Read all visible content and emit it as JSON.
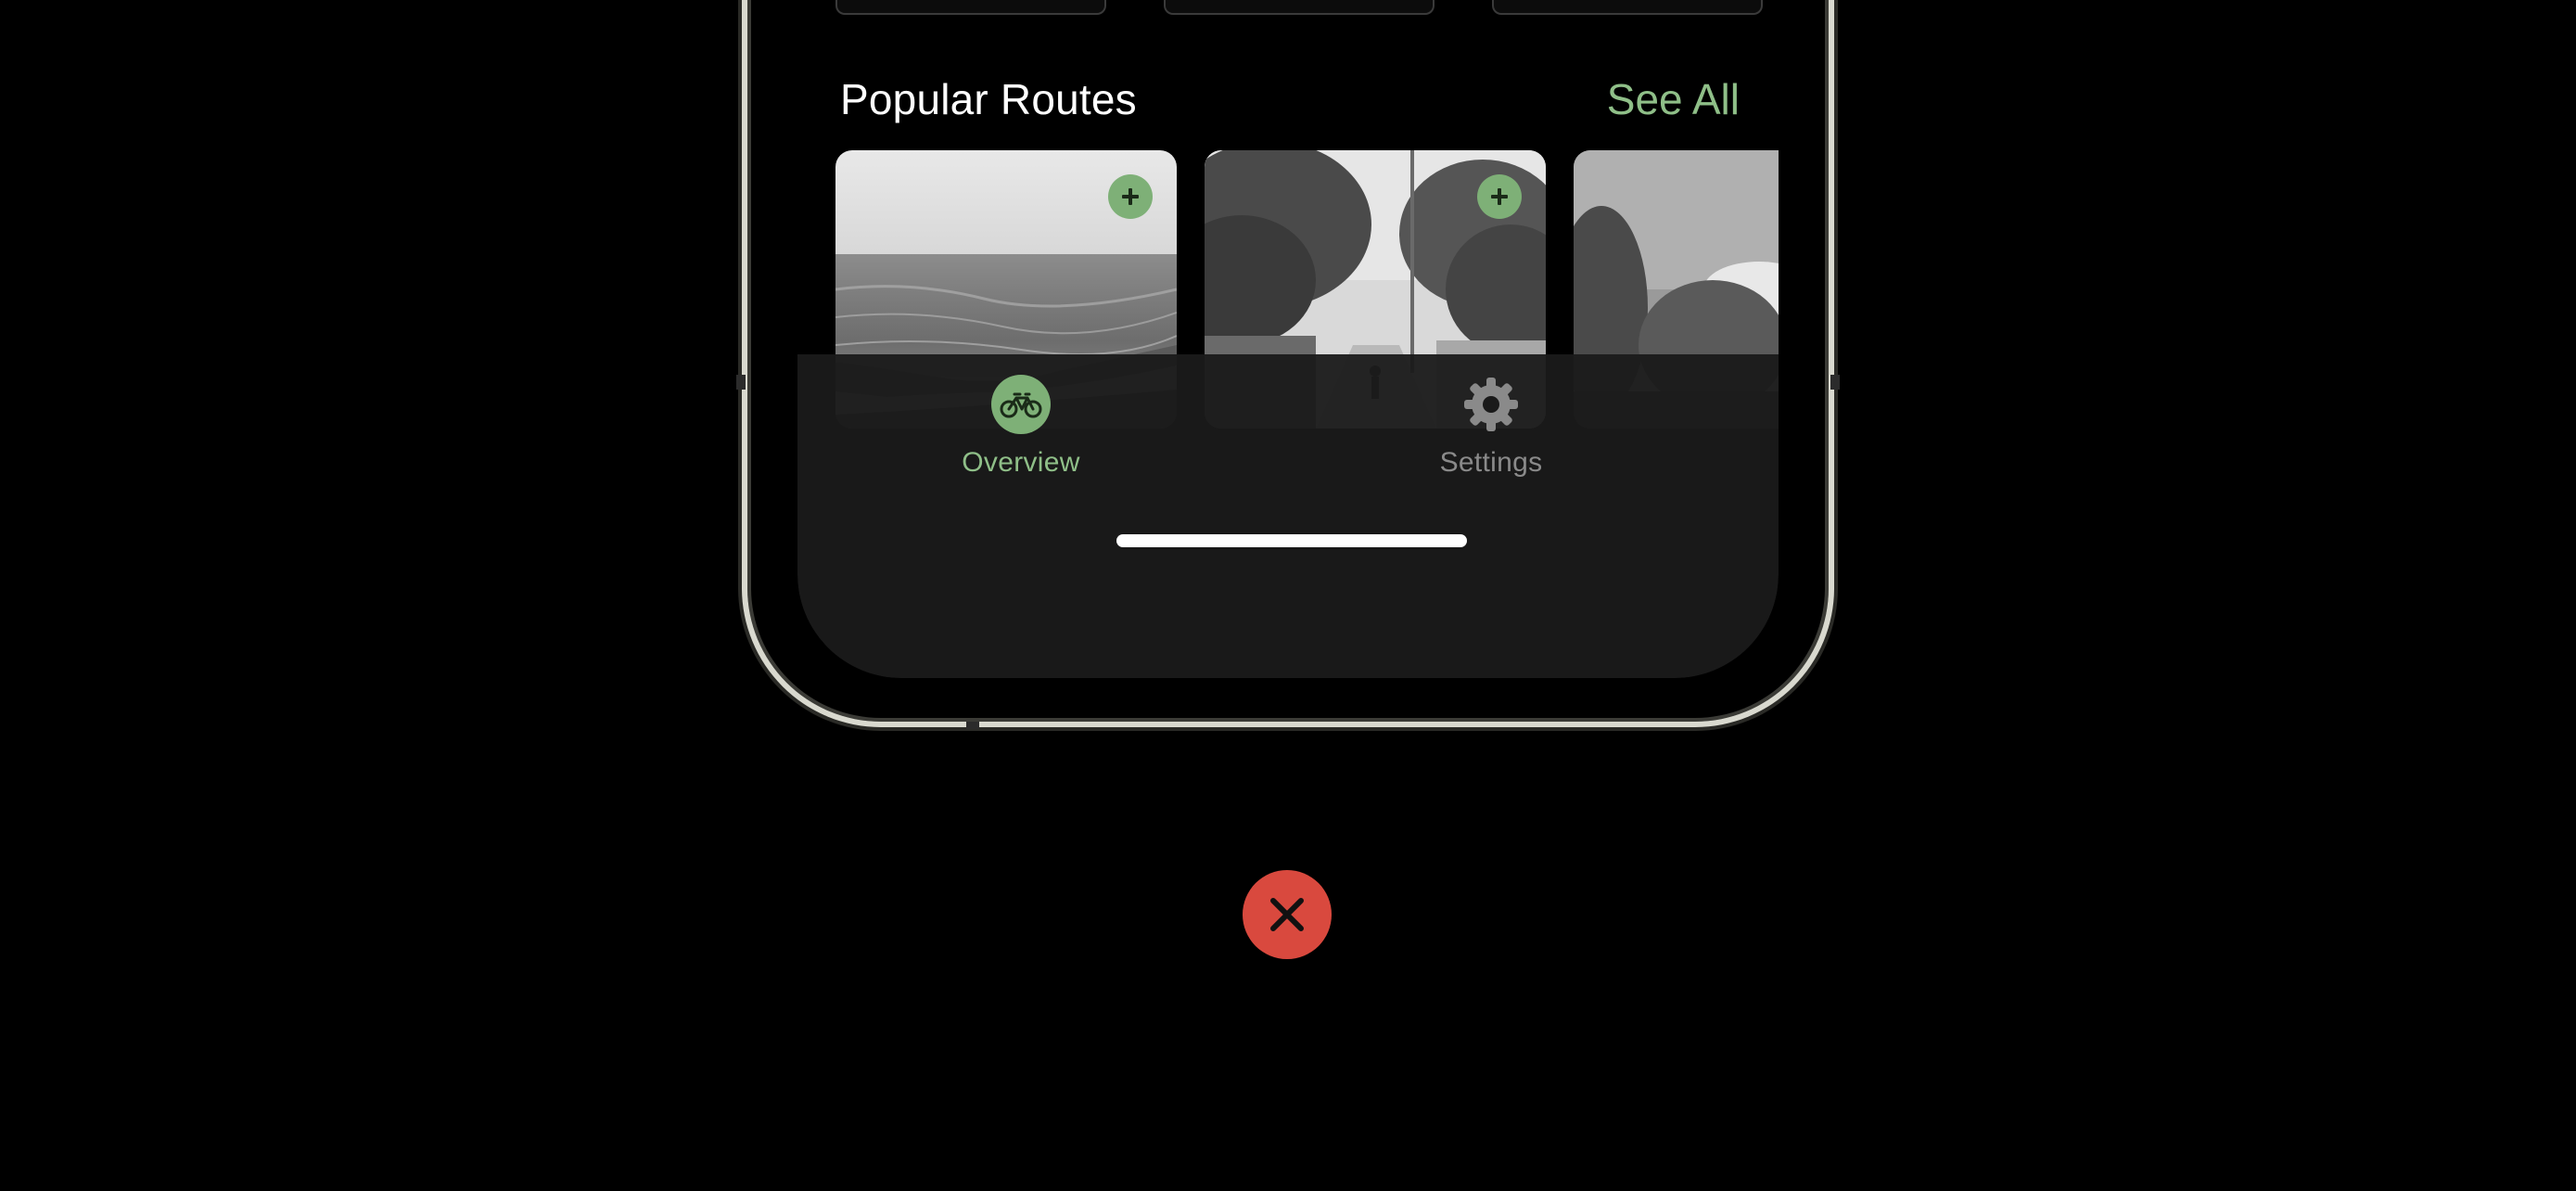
{
  "section": {
    "title": "Popular Routes",
    "see_all_label": "See All"
  },
  "routes": [
    {
      "image": "coastal-road-cyclist-photo",
      "action_icon": "plus-icon"
    },
    {
      "image": "village-lane-cyclist-photo",
      "action_icon": "plus-icon"
    },
    {
      "image": "forest-trail-photo",
      "action_icon": ""
    }
  ],
  "tab_bar": {
    "tabs": [
      {
        "label": "Overview",
        "icon": "bicycle-icon",
        "selected": true
      },
      {
        "label": "Settings",
        "icon": "gear-icon",
        "selected": false
      }
    ]
  },
  "close_button": {
    "icon": "close-icon"
  },
  "colors": {
    "background": "#000000",
    "accent_green": "#7eb077",
    "accent_green_text": "#8fbf88",
    "tab_inactive": "#8a8a8a",
    "close_red": "#d9493e",
    "tab_bar_bg": "#1a1a1a"
  }
}
